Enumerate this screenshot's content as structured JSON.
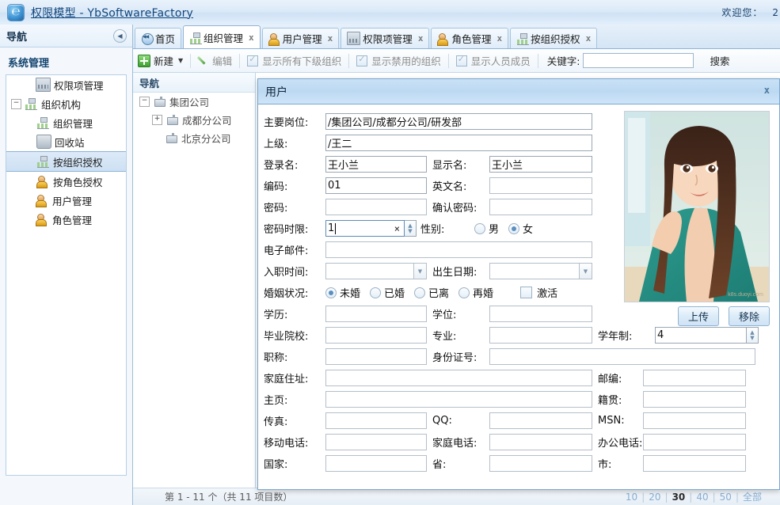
{
  "titlebar": {
    "app_title": "权限模型 - YbSoftwareFactory",
    "logo_glyph": "℮",
    "welcome": "欢迎您：",
    "user": "2"
  },
  "leftnav": {
    "header": "导航",
    "collapse_glyph": "◀",
    "group_title": "系统管理",
    "items": [
      {
        "label": "权限项管理",
        "icon": "permission-grid-icon",
        "level": 1,
        "expander": "",
        "selected": false
      },
      {
        "label": "组织机构",
        "icon": "org-chart-icon",
        "level": 1,
        "expander": "−",
        "selected": false
      },
      {
        "label": "组织管理",
        "icon": "org-manage-icon",
        "level": 2,
        "expander": "",
        "selected": false
      },
      {
        "label": "回收站",
        "icon": "recycle-bin-icon",
        "level": 2,
        "expander": "",
        "selected": false
      },
      {
        "label": "按组织授权",
        "icon": "org-grant-icon",
        "level": 2,
        "expander": "",
        "selected": true
      },
      {
        "label": "按角色授权",
        "icon": "role-grant-icon",
        "level": 2,
        "expander": "",
        "selected": false
      },
      {
        "label": "用户管理",
        "icon": "user-manage-icon",
        "level": 1.5,
        "expander": "",
        "selected": false
      },
      {
        "label": "角色管理",
        "icon": "role-manage-icon",
        "level": 1.5,
        "expander": "",
        "selected": false
      }
    ]
  },
  "tabs": [
    {
      "label": "首页",
      "icon": "home-icon",
      "closable": false,
      "active": false
    },
    {
      "label": "组织管理",
      "icon": "org-chart-icon",
      "closable": true,
      "active": true
    },
    {
      "label": "用户管理",
      "icon": "user-manage-icon",
      "closable": true,
      "active": false
    },
    {
      "label": "权限项管理",
      "icon": "permission-grid-icon",
      "closable": true,
      "active": false
    },
    {
      "label": "角色管理",
      "icon": "role-manage-icon",
      "closable": true,
      "active": false
    },
    {
      "label": "按组织授权",
      "icon": "org-grant-icon",
      "closable": true,
      "active": false
    }
  ],
  "tab_close_glyph": "x",
  "toolbar": {
    "new_label": "新建",
    "new_caret": "▼",
    "edit_label": "编辑",
    "checkboxes": [
      {
        "label": "显示所有下级组织",
        "checked": true
      },
      {
        "label": "显示禁用的组织",
        "checked": true
      },
      {
        "label": "显示人员成员",
        "checked": true
      }
    ],
    "keyword_label": "关键字:",
    "keyword_value": "",
    "search_label": "搜索"
  },
  "tree": {
    "header": "导航",
    "nodes": [
      {
        "label": "集团公司",
        "level": 1,
        "expander": "−"
      },
      {
        "label": "成都分公司",
        "level": 2,
        "expander": "+"
      },
      {
        "label": "北京分公司",
        "level": 3,
        "expander": ""
      }
    ]
  },
  "statusbar": {
    "summary": "第 1 - 11 个（共 11 项目数）",
    "page_sizes": [
      "10",
      "20",
      "30",
      "40",
      "50",
      "全部"
    ],
    "current_page_size": "30",
    "separator": "|"
  },
  "dialog": {
    "title": "用户",
    "close_glyph": "x",
    "rows": {
      "main_post": {
        "label": "主要岗位:",
        "value": "/集团公司/成都分公司/研发部"
      },
      "superior": {
        "label": "上级:",
        "value": "/王二"
      },
      "login_name": {
        "label": "登录名:",
        "value": "王小兰"
      },
      "display_name": {
        "label": "显示名:",
        "value": "王小兰"
      },
      "code": {
        "label": "编码:",
        "value": "01"
      },
      "english_name": {
        "label": "英文名:",
        "value": ""
      },
      "password": {
        "label": "密码:",
        "value": ""
      },
      "confirm_password": {
        "label": "确认密码:",
        "value": ""
      },
      "password_period": {
        "label": "密码时限:",
        "value": "1",
        "clear_glyph": "×"
      },
      "gender": {
        "label": "性别:",
        "options": [
          "男",
          "女"
        ],
        "selected": "女"
      },
      "email": {
        "label": "电子邮件:",
        "value": ""
      },
      "hire_date": {
        "label": "入职时间:",
        "value": ""
      },
      "birth_date": {
        "label": "出生日期:",
        "value": ""
      },
      "marital": {
        "label": "婚姻状况:",
        "options": [
          "未婚",
          "已婚",
          "已离",
          "再婚"
        ],
        "selected": "未婚"
      },
      "active": {
        "label": "激活",
        "checked": false
      },
      "education": {
        "label": "学历:",
        "value": ""
      },
      "degree": {
        "label": "学位:",
        "value": ""
      },
      "school": {
        "label": "毕业院校:",
        "value": ""
      },
      "major": {
        "label": "专业:",
        "value": ""
      },
      "school_years": {
        "label": "学年制:",
        "value": "4"
      },
      "job_title": {
        "label": "职称:",
        "value": ""
      },
      "id_number": {
        "label": "身份证号:",
        "value": ""
      },
      "home_address": {
        "label": "家庭住址:",
        "value": ""
      },
      "postcode": {
        "label": "邮编:",
        "value": ""
      },
      "homepage": {
        "label": "主页:",
        "value": ""
      },
      "native_place": {
        "label": "籍贯:",
        "value": ""
      },
      "fax": {
        "label": "传真:",
        "value": ""
      },
      "qq": {
        "label": "QQ:",
        "value": ""
      },
      "msn": {
        "label": "MSN:",
        "value": ""
      },
      "mobile": {
        "label": "移动电话:",
        "value": ""
      },
      "home_phone": {
        "label": "家庭电话:",
        "value": ""
      },
      "office_phone": {
        "label": "办公电话:",
        "value": ""
      },
      "country": {
        "label": "国家:",
        "value": ""
      },
      "province": {
        "label": "省:",
        "value": ""
      },
      "city": {
        "label": "市:",
        "value": ""
      }
    },
    "upload_label": "上传",
    "remove_label": "移除",
    "photo_alt": "user-photo",
    "dropdown_glyph": "▼",
    "spin_up": "▲",
    "spin_down": "▼"
  }
}
